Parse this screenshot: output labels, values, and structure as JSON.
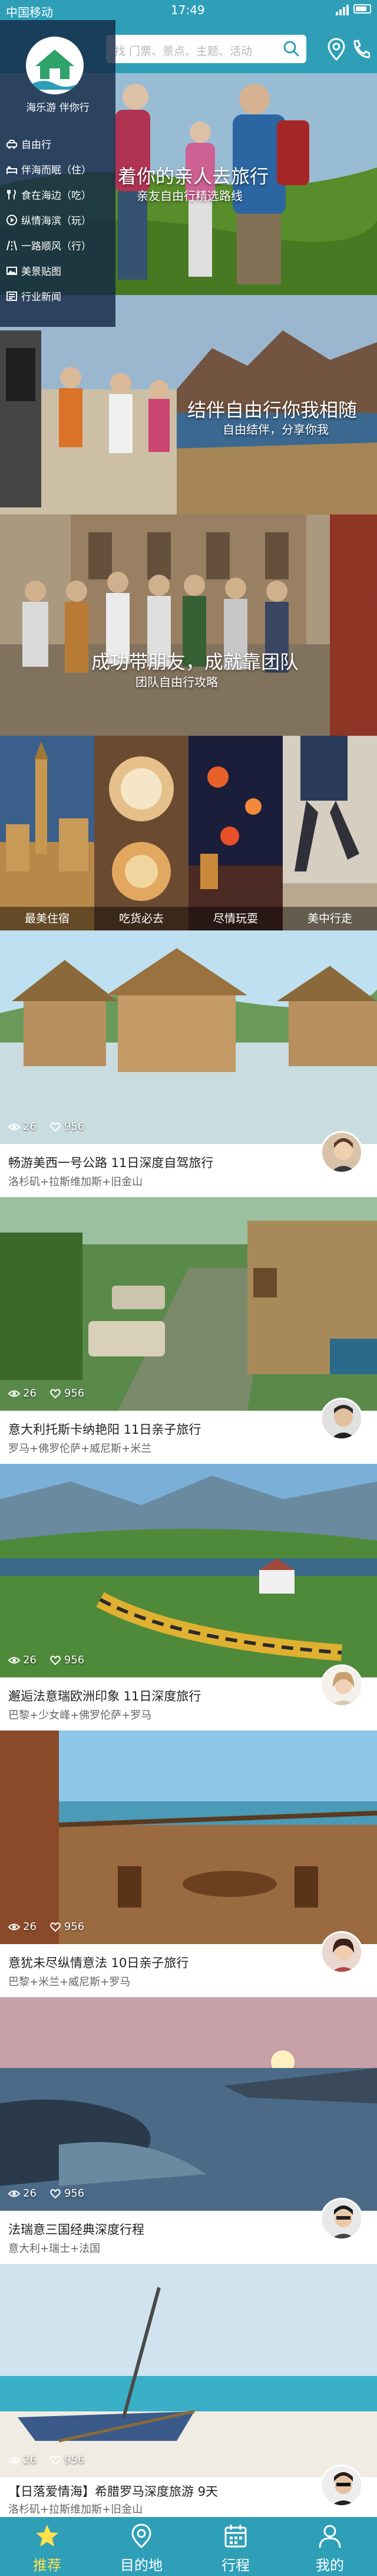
{
  "status": {
    "carrier": "中国移动",
    "time": "17:49"
  },
  "search": {
    "placeholder": "找 门票、景点、主题、活动"
  },
  "menu": {
    "slogan": "海乐游 伴你行",
    "items": [
      {
        "label": "自由行",
        "icon": "car-icon"
      },
      {
        "label": "伴海而眠（住）",
        "icon": "bed-icon"
      },
      {
        "label": "食在海边（吃）",
        "icon": "food-icon"
      },
      {
        "label": "纵情海滨（玩）",
        "icon": "play-icon"
      },
      {
        "label": "一路顺风（行）",
        "icon": "road-icon"
      },
      {
        "label": "美景贴图",
        "icon": "image-icon"
      },
      {
        "label": "行业新闻",
        "icon": "news-icon"
      }
    ]
  },
  "banners": [
    {
      "title": "着你的亲人去旅行",
      "subtitle": "亲友自由行精选路线"
    },
    {
      "title": "结伴自由行你我相随",
      "subtitle": "自由结伴，分享你我"
    },
    {
      "title": "成功带朋友，成就靠团队",
      "subtitle": "团队自由行攻略"
    }
  ],
  "categories": [
    {
      "label": "最美住宿"
    },
    {
      "label": "吃货必去"
    },
    {
      "label": "尽情玩耍"
    },
    {
      "label": "美中行走"
    }
  ],
  "trips": [
    {
      "views": "26",
      "likes": "956",
      "title": "畅游美西一号公路 11日深度自驾旅行",
      "route": "洛杉矶+拉斯维加斯+旧金山"
    },
    {
      "views": "26",
      "likes": "956",
      "title": "意大利托斯卡纳艳阳 11日亲子旅行",
      "route": "罗马+佛罗伦萨+威尼斯+米兰"
    },
    {
      "views": "26",
      "likes": "956",
      "title": "邂逅法意瑞欧洲印象 11日深度旅行",
      "route": "巴黎+少女峰+佛罗伦萨+罗马"
    },
    {
      "views": "26",
      "likes": "956",
      "title": "意犹未尽纵情意法 10日亲子旅行",
      "route": "巴黎+米兰+威尼斯+罗马"
    },
    {
      "views": "26",
      "likes": "956",
      "title": "法瑞意三国经典深度行程",
      "route": "意大利+瑞士+法国"
    },
    {
      "views": "26",
      "likes": "956",
      "title": "【日落爱情海】希腊罗马深度旅游 9天",
      "route": "洛杉矶+拉斯维加斯+旧金山"
    }
  ],
  "nav": [
    {
      "label": "推荐",
      "icon": "star-icon",
      "active": true
    },
    {
      "label": "目的地",
      "icon": "location-icon",
      "active": false
    },
    {
      "label": "行程",
      "icon": "calendar-icon",
      "active": false
    },
    {
      "label": "我的",
      "icon": "user-icon",
      "active": false
    }
  ],
  "colors": {
    "primary": "#2f9fb8",
    "nav_active": "#ffe14d"
  }
}
